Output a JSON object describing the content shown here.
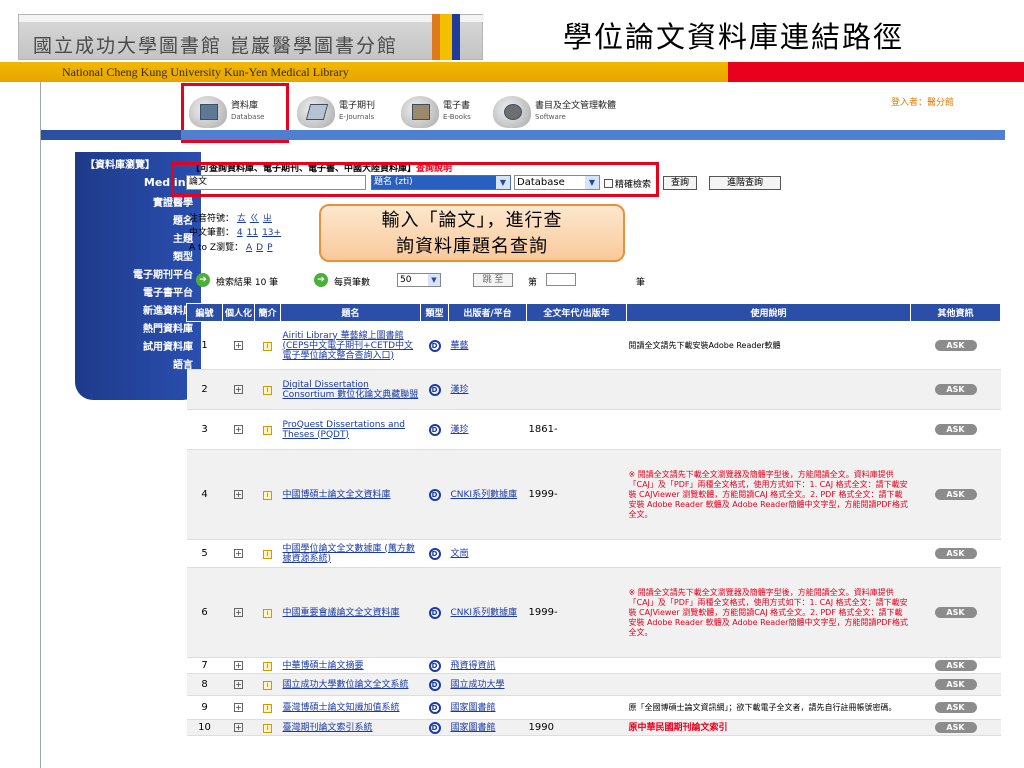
{
  "slide": {
    "library_name": "國立成功大學圖書館 崑巖醫學圖書分館",
    "title": "學位論文資料庫連結路徑",
    "subtitle_en": "National Cheng Kung University Kun-Yen Medical Library",
    "colors": {
      "accent_red": "#e8001c",
      "band_yellow": "#f2c000",
      "nav_blue": "#2b4fa8"
    }
  },
  "topnav": {
    "items": [
      {
        "zh": "資料庫",
        "en": "Database",
        "icon": "database-icon"
      },
      {
        "zh": "電子期刊",
        "en": "E-Journals",
        "icon": "ejournals-icon"
      },
      {
        "zh": "電子書",
        "en": "E-Books",
        "icon": "ebooks-icon"
      },
      {
        "zh": "書目及全文管理軟體",
        "en": "Software",
        "icon": "software-icon"
      }
    ],
    "login": "登入者：醫分館"
  },
  "sidebar": {
    "title": "【資料庫瀏覽】",
    "items": [
      "Medline",
      "實證醫學",
      "題名",
      "主題",
      "類型",
      "電子期刊平台",
      "電子書平台",
      "新進資料庫",
      "熱門資料庫",
      "試用資料庫",
      "語言"
    ]
  },
  "search": {
    "header": "【可查詢資料庫、電子期刊、電子書、中國大陸資料庫】",
    "help": "查詢說明",
    "input_value": "論文",
    "field": "題名 (zti)",
    "scope": "Database",
    "exact_label": "精確檢索",
    "search_btn": "查詢",
    "adv_btn": "進階查詢"
  },
  "browse": {
    "zhuyin_label": "注音符號：",
    "zhuyin": [
      "ㄊ",
      "ㄍ",
      "ㄓ"
    ],
    "stroke_label": "中文筆劃：",
    "strokes": [
      "4",
      "11",
      "13+"
    ],
    "az_label": "A to Z瀏覽：",
    "letters": [
      "A",
      "D",
      "P"
    ]
  },
  "callout": {
    "line1": "輸入「論文」，進行查",
    "line2": "詢資料庫題名查詢"
  },
  "summary": {
    "result_label": "檢索結果 10 筆",
    "per_page_label": "每頁筆數",
    "per_page": "50",
    "jump": "跳 至",
    "page_prefix": "第",
    "page_suffix": "筆"
  },
  "table": {
    "headers": [
      "編號",
      "個人化",
      "簡介",
      "題名",
      "類型",
      "出版者/平台",
      "全文年代/出版年",
      "使用說明",
      "其他資訊"
    ],
    "rows": [
      {
        "no": "1",
        "title": "Airiti Library 華藝線上圖書館 (CEPS中文電子期刊+CETD中文電子學位論文整合查詢入口)",
        "type": "D",
        "publisher": "華藝",
        "year": "",
        "note": "閱讀全文請先下載安裝Adobe Reader軟體",
        "note_style": "normal",
        "ask": "ASK"
      },
      {
        "no": "2",
        "title": "Digital Dissertation Consortium 數位化論文典藏聯盟",
        "type": "D",
        "publisher": "漢珍",
        "year": "",
        "note": "",
        "note_style": "normal",
        "ask": "ASK"
      },
      {
        "no": "3",
        "title": "ProQuest Dissertations and Theses (PQDT)",
        "type": "D",
        "publisher": "漢珍",
        "year": "1861-",
        "note": "",
        "note_style": "normal",
        "ask": "ASK"
      },
      {
        "no": "4",
        "title": "中國博碩士論文全文資料庫",
        "type": "D",
        "publisher": "CNKI系列數據庫",
        "year": "1999-",
        "note": "※ 閱讀全文請先下載全文瀏覽器及簡體字型後，方能閱讀全文。資料庫提供「CAJ」及「PDF」兩種全文格式，使用方式如下：1. CAJ 格式全文：請下載安裝 CAJViewer 瀏覽軟體，方能閱讀CAJ 格式全文。2. PDF 格式全文：請下載安裝 Adobe Reader 軟體及 Adobe Reader簡體中文字型，方能閱讀PDF格式全文。",
        "note_style": "red",
        "ask": "ASK"
      },
      {
        "no": "5",
        "title": "中國學位論文全文數據庫 (萬方數據資源系統)",
        "type": "D",
        "publisher": "文崗",
        "year": "",
        "note": "",
        "note_style": "normal",
        "ask": "ASK"
      },
      {
        "no": "6",
        "title": "中國重要會議論文全文資料庫",
        "type": "D",
        "publisher": "CNKI系列數據庫",
        "year": "1999-",
        "note": "※ 閱讀全文請先下載全文瀏覽器及簡體字型後，方能閱讀全文。資料庫提供「CAJ」及「PDF」兩種全文格式，使用方式如下：1. CAJ 格式全文：請下載安裝 CAJViewer 瀏覽軟體，方能閱讀CAJ 格式全文。2. PDF 格式全文：請下載安裝 Adobe Reader 軟體及 Adobe Reader簡體中文字型，方能閱讀PDF格式全文。",
        "note_style": "red",
        "ask": "ASK"
      },
      {
        "no": "7",
        "title": "中華博碩士論文摘要",
        "type": "D",
        "publisher": "飛資得資訊",
        "year": "",
        "note": "",
        "note_style": "normal",
        "ask": "ASK"
      },
      {
        "no": "8",
        "title": "國立成功大學數位論文全文系統",
        "type": "D",
        "publisher": "國立成功大學",
        "year": "",
        "note": "",
        "note_style": "normal",
        "ask": "ASK"
      },
      {
        "no": "9",
        "title": "臺灣博碩士論文知識加值系統",
        "type": "D",
        "publisher": "國家圖書館",
        "year": "",
        "note": "原「全國博碩士論文資訊網」；欲下載電子全文者，請先自行註冊帳號密碼。",
        "note_style": "normal",
        "ask": "ASK"
      },
      {
        "no": "10",
        "title": "臺灣期刊論文索引系統",
        "type": "D",
        "publisher": "國家圖書館",
        "year": "1990",
        "note": "原中華民國期刊論文索引",
        "note_style": "bold-red",
        "ask": "ASK"
      }
    ]
  }
}
